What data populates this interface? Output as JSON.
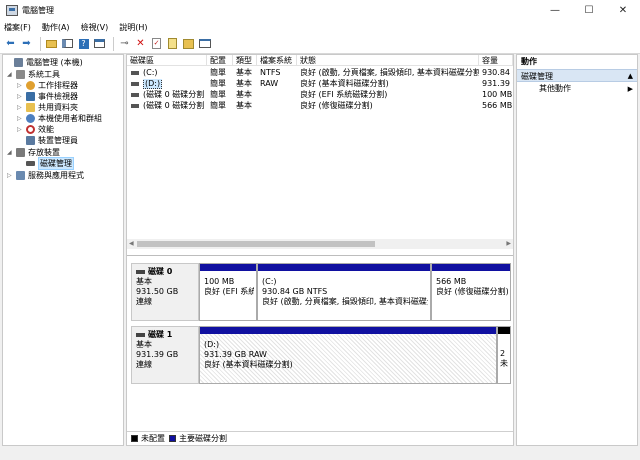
{
  "window": {
    "title": "電腦管理",
    "minimize": "—",
    "maximize": "☐",
    "close": "✕"
  },
  "menu": [
    "檔案(F)",
    "動作(A)",
    "檢視(V)",
    "說明(H)"
  ],
  "tree": [
    {
      "label": "電腦管理 (本機)",
      "icon_color": "#6b7f99",
      "expander": ""
    },
    {
      "label": "系統工具",
      "icon_color": "#8a8a8a",
      "expander": "◢"
    },
    {
      "label": "工作排程器",
      "icon_color": "#e0a030",
      "expander": "▷"
    },
    {
      "label": "事件檢視器",
      "icon_color": "#3a6ea5",
      "expander": "▷"
    },
    {
      "label": "共用資料夾",
      "icon_color": "#e8c050",
      "expander": "▷"
    },
    {
      "label": "本機使用者和群組",
      "icon_color": "#4d7fbf",
      "expander": "▷"
    },
    {
      "label": "效能",
      "icon_color": "#c03030",
      "expander": "▷"
    },
    {
      "label": "裝置管理員",
      "icon_color": "#5a7aa0",
      "expander": ""
    },
    {
      "label": "存放裝置",
      "icon_color": "#7a7a7a",
      "expander": "◢"
    },
    {
      "label": "磁碟管理",
      "icon_color": "#555555",
      "expander": ""
    },
    {
      "label": "服務與應用程式",
      "icon_color": "#6a8ab0",
      "expander": "▷"
    }
  ],
  "volume_headers": [
    "磁碟區",
    "配置",
    "類型",
    "檔案系統",
    "狀態",
    "容量"
  ],
  "volumes": [
    {
      "name": "(C:)",
      "layout": "簡單",
      "type": "基本",
      "fs": "NTFS",
      "status": "良好 (啟動, 分頁檔案, 損毀傾印, 基本資料磁碟分割)",
      "capacity": "930.84 G"
    },
    {
      "name": "(D:)",
      "layout": "簡單",
      "type": "基本",
      "fs": "RAW",
      "status": "良好 (基本資料磁碟分割)",
      "capacity": "931.39 G"
    },
    {
      "name": "(磁碟 0 磁碟分割 1)",
      "layout": "簡單",
      "type": "基本",
      "fs": "",
      "status": "良好 (EFI 系統磁碟分割)",
      "capacity": "100 MB"
    },
    {
      "name": "(磁碟 0 磁碟分割 4)",
      "layout": "簡單",
      "type": "基本",
      "fs": "",
      "status": "良好 (修復磁碟分割)",
      "capacity": "566 MB"
    }
  ],
  "disks": [
    {
      "name": "磁碟 0",
      "type": "基本",
      "size": "931.50 GB",
      "state": "連線",
      "partitions": [
        {
          "name": "",
          "size": "100 MB",
          "status": "良好 (EFI 系統"
        },
        {
          "name": "(C:)",
          "size": "930.84 GB NTFS",
          "status": "良好 (啟動, 分頁檔案, 損毀傾印, 基本資料磁碟分"
        },
        {
          "name": "",
          "size": "566 MB",
          "status": "良好 (修復磁碟分割)"
        }
      ]
    },
    {
      "name": "磁碟 1",
      "type": "基本",
      "size": "931.39 GB",
      "state": "連線",
      "partitions": [
        {
          "name": "(D:)",
          "size": "931.39 GB RAW",
          "status": "良好 (基本資料磁碟分割)"
        },
        {
          "name": "",
          "size": "2",
          "status": "未"
        }
      ]
    }
  ],
  "legend": [
    {
      "label": "未配置",
      "color": "#000000"
    },
    {
      "label": "主要磁碟分割",
      "color": "#1010a0"
    }
  ],
  "actions": {
    "header": "動作",
    "section": "磁碟管理",
    "section_caret": "▲",
    "item": "其他動作",
    "item_caret": "▶"
  }
}
